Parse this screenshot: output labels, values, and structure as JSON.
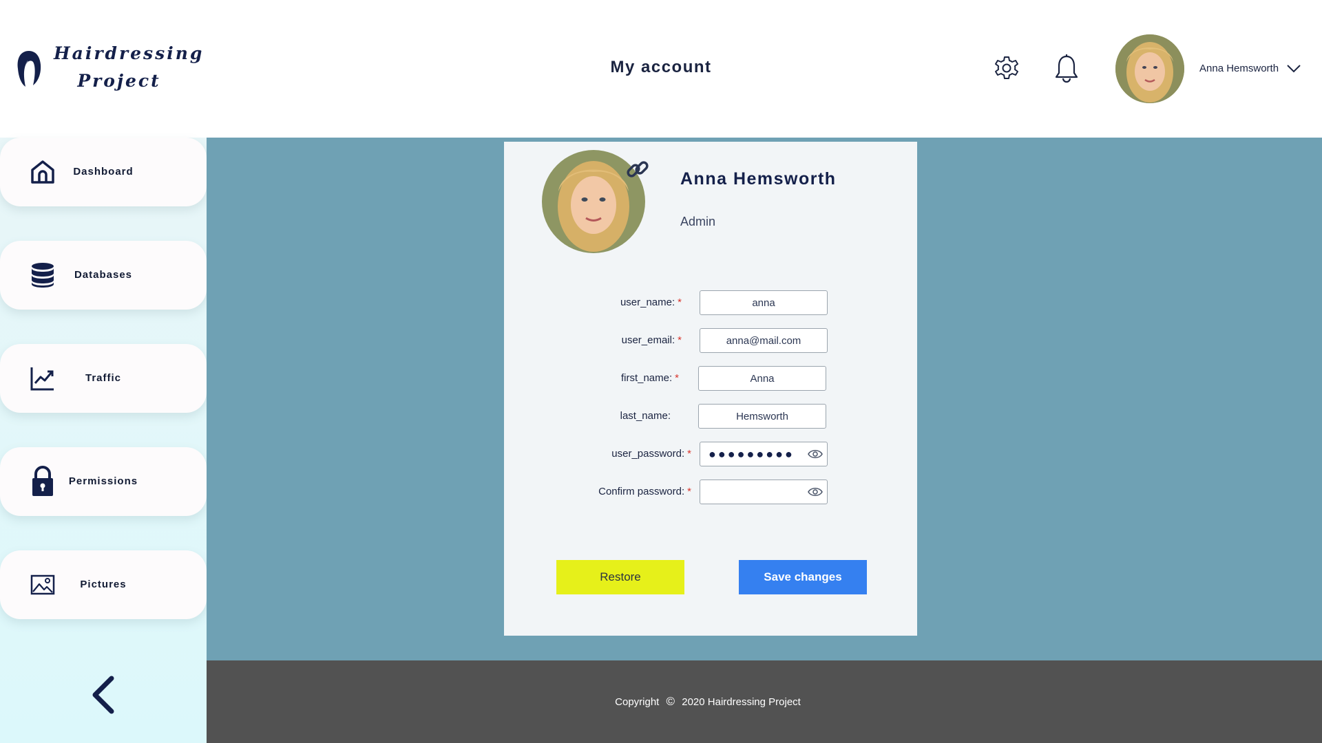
{
  "app": {
    "logo_line1": "Hairdressing",
    "logo_line2": "Project",
    "page_title": "My account"
  },
  "header": {
    "user_name": "Anna Hemsworth",
    "icons": [
      "gear-icon",
      "bell-icon",
      "chevron-down-icon"
    ]
  },
  "sidebar": {
    "items": [
      {
        "label": "Dashboard",
        "icon": "home-icon"
      },
      {
        "label": "Databases",
        "icon": "database-icon"
      },
      {
        "label": "Traffic",
        "icon": "chart-line-icon"
      },
      {
        "label": "Permissions",
        "icon": "lock-icon"
      },
      {
        "label": "Pictures",
        "icon": "image-icon"
      }
    ],
    "collapse_icon": "chevron-left-icon"
  },
  "profile": {
    "name": "Anna Hemsworth",
    "role": "Admin"
  },
  "form": {
    "fields": [
      {
        "label": "user_name:",
        "required": "*",
        "value": "anna"
      },
      {
        "label": "user_email:",
        "required": "*",
        "value": "anna@mail.com"
      },
      {
        "label": "first_name:",
        "required": "*",
        "value": "Anna"
      },
      {
        "label": "last_name:",
        "required": "",
        "value": "Hemsworth"
      },
      {
        "label": "user_password:",
        "required": "*",
        "value": "●●●●●●●●●"
      },
      {
        "label": "Confirm password:",
        "required": "*",
        "value": ""
      }
    ],
    "restore_label": "Restore",
    "save_label": "Save changes"
  },
  "colors": {
    "brand_navy": "#14204a",
    "main_bg": "#6fa1b4",
    "restore_button": "#e6f01a",
    "save_button": "#3580f0",
    "footer_bg": "#525252",
    "required": "#d9342b"
  },
  "footer": {
    "copyright_label": "Copyright",
    "copyright_symbol": "©",
    "copyright_text": "2020 Hairdressing Project"
  }
}
